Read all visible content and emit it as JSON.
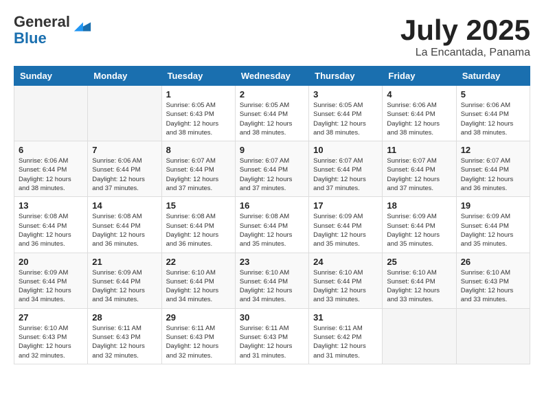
{
  "logo": {
    "general": "General",
    "blue": "Blue"
  },
  "header": {
    "month": "July 2025",
    "location": "La Encantada, Panama"
  },
  "days_of_week": [
    "Sunday",
    "Monday",
    "Tuesday",
    "Wednesday",
    "Thursday",
    "Friday",
    "Saturday"
  ],
  "weeks": [
    [
      {
        "day": "",
        "sunrise": "",
        "sunset": "",
        "daylight": ""
      },
      {
        "day": "",
        "sunrise": "",
        "sunset": "",
        "daylight": ""
      },
      {
        "day": "1",
        "sunrise": "Sunrise: 6:05 AM",
        "sunset": "Sunset: 6:43 PM",
        "daylight": "Daylight: 12 hours and 38 minutes."
      },
      {
        "day": "2",
        "sunrise": "Sunrise: 6:05 AM",
        "sunset": "Sunset: 6:44 PM",
        "daylight": "Daylight: 12 hours and 38 minutes."
      },
      {
        "day": "3",
        "sunrise": "Sunrise: 6:05 AM",
        "sunset": "Sunset: 6:44 PM",
        "daylight": "Daylight: 12 hours and 38 minutes."
      },
      {
        "day": "4",
        "sunrise": "Sunrise: 6:06 AM",
        "sunset": "Sunset: 6:44 PM",
        "daylight": "Daylight: 12 hours and 38 minutes."
      },
      {
        "day": "5",
        "sunrise": "Sunrise: 6:06 AM",
        "sunset": "Sunset: 6:44 PM",
        "daylight": "Daylight: 12 hours and 38 minutes."
      }
    ],
    [
      {
        "day": "6",
        "sunrise": "Sunrise: 6:06 AM",
        "sunset": "Sunset: 6:44 PM",
        "daylight": "Daylight: 12 hours and 38 minutes."
      },
      {
        "day": "7",
        "sunrise": "Sunrise: 6:06 AM",
        "sunset": "Sunset: 6:44 PM",
        "daylight": "Daylight: 12 hours and 37 minutes."
      },
      {
        "day": "8",
        "sunrise": "Sunrise: 6:07 AM",
        "sunset": "Sunset: 6:44 PM",
        "daylight": "Daylight: 12 hours and 37 minutes."
      },
      {
        "day": "9",
        "sunrise": "Sunrise: 6:07 AM",
        "sunset": "Sunset: 6:44 PM",
        "daylight": "Daylight: 12 hours and 37 minutes."
      },
      {
        "day": "10",
        "sunrise": "Sunrise: 6:07 AM",
        "sunset": "Sunset: 6:44 PM",
        "daylight": "Daylight: 12 hours and 37 minutes."
      },
      {
        "day": "11",
        "sunrise": "Sunrise: 6:07 AM",
        "sunset": "Sunset: 6:44 PM",
        "daylight": "Daylight: 12 hours and 37 minutes."
      },
      {
        "day": "12",
        "sunrise": "Sunrise: 6:07 AM",
        "sunset": "Sunset: 6:44 PM",
        "daylight": "Daylight: 12 hours and 36 minutes."
      }
    ],
    [
      {
        "day": "13",
        "sunrise": "Sunrise: 6:08 AM",
        "sunset": "Sunset: 6:44 PM",
        "daylight": "Daylight: 12 hours and 36 minutes."
      },
      {
        "day": "14",
        "sunrise": "Sunrise: 6:08 AM",
        "sunset": "Sunset: 6:44 PM",
        "daylight": "Daylight: 12 hours and 36 minutes."
      },
      {
        "day": "15",
        "sunrise": "Sunrise: 6:08 AM",
        "sunset": "Sunset: 6:44 PM",
        "daylight": "Daylight: 12 hours and 36 minutes."
      },
      {
        "day": "16",
        "sunrise": "Sunrise: 6:08 AM",
        "sunset": "Sunset: 6:44 PM",
        "daylight": "Daylight: 12 hours and 35 minutes."
      },
      {
        "day": "17",
        "sunrise": "Sunrise: 6:09 AM",
        "sunset": "Sunset: 6:44 PM",
        "daylight": "Daylight: 12 hours and 35 minutes."
      },
      {
        "day": "18",
        "sunrise": "Sunrise: 6:09 AM",
        "sunset": "Sunset: 6:44 PM",
        "daylight": "Daylight: 12 hours and 35 minutes."
      },
      {
        "day": "19",
        "sunrise": "Sunrise: 6:09 AM",
        "sunset": "Sunset: 6:44 PM",
        "daylight": "Daylight: 12 hours and 35 minutes."
      }
    ],
    [
      {
        "day": "20",
        "sunrise": "Sunrise: 6:09 AM",
        "sunset": "Sunset: 6:44 PM",
        "daylight": "Daylight: 12 hours and 34 minutes."
      },
      {
        "day": "21",
        "sunrise": "Sunrise: 6:09 AM",
        "sunset": "Sunset: 6:44 PM",
        "daylight": "Daylight: 12 hours and 34 minutes."
      },
      {
        "day": "22",
        "sunrise": "Sunrise: 6:10 AM",
        "sunset": "Sunset: 6:44 PM",
        "daylight": "Daylight: 12 hours and 34 minutes."
      },
      {
        "day": "23",
        "sunrise": "Sunrise: 6:10 AM",
        "sunset": "Sunset: 6:44 PM",
        "daylight": "Daylight: 12 hours and 34 minutes."
      },
      {
        "day": "24",
        "sunrise": "Sunrise: 6:10 AM",
        "sunset": "Sunset: 6:44 PM",
        "daylight": "Daylight: 12 hours and 33 minutes."
      },
      {
        "day": "25",
        "sunrise": "Sunrise: 6:10 AM",
        "sunset": "Sunset: 6:44 PM",
        "daylight": "Daylight: 12 hours and 33 minutes."
      },
      {
        "day": "26",
        "sunrise": "Sunrise: 6:10 AM",
        "sunset": "Sunset: 6:43 PM",
        "daylight": "Daylight: 12 hours and 33 minutes."
      }
    ],
    [
      {
        "day": "27",
        "sunrise": "Sunrise: 6:10 AM",
        "sunset": "Sunset: 6:43 PM",
        "daylight": "Daylight: 12 hours and 32 minutes."
      },
      {
        "day": "28",
        "sunrise": "Sunrise: 6:11 AM",
        "sunset": "Sunset: 6:43 PM",
        "daylight": "Daylight: 12 hours and 32 minutes."
      },
      {
        "day": "29",
        "sunrise": "Sunrise: 6:11 AM",
        "sunset": "Sunset: 6:43 PM",
        "daylight": "Daylight: 12 hours and 32 minutes."
      },
      {
        "day": "30",
        "sunrise": "Sunrise: 6:11 AM",
        "sunset": "Sunset: 6:43 PM",
        "daylight": "Daylight: 12 hours and 31 minutes."
      },
      {
        "day": "31",
        "sunrise": "Sunrise: 6:11 AM",
        "sunset": "Sunset: 6:42 PM",
        "daylight": "Daylight: 12 hours and 31 minutes."
      },
      {
        "day": "",
        "sunrise": "",
        "sunset": "",
        "daylight": ""
      },
      {
        "day": "",
        "sunrise": "",
        "sunset": "",
        "daylight": ""
      }
    ]
  ]
}
